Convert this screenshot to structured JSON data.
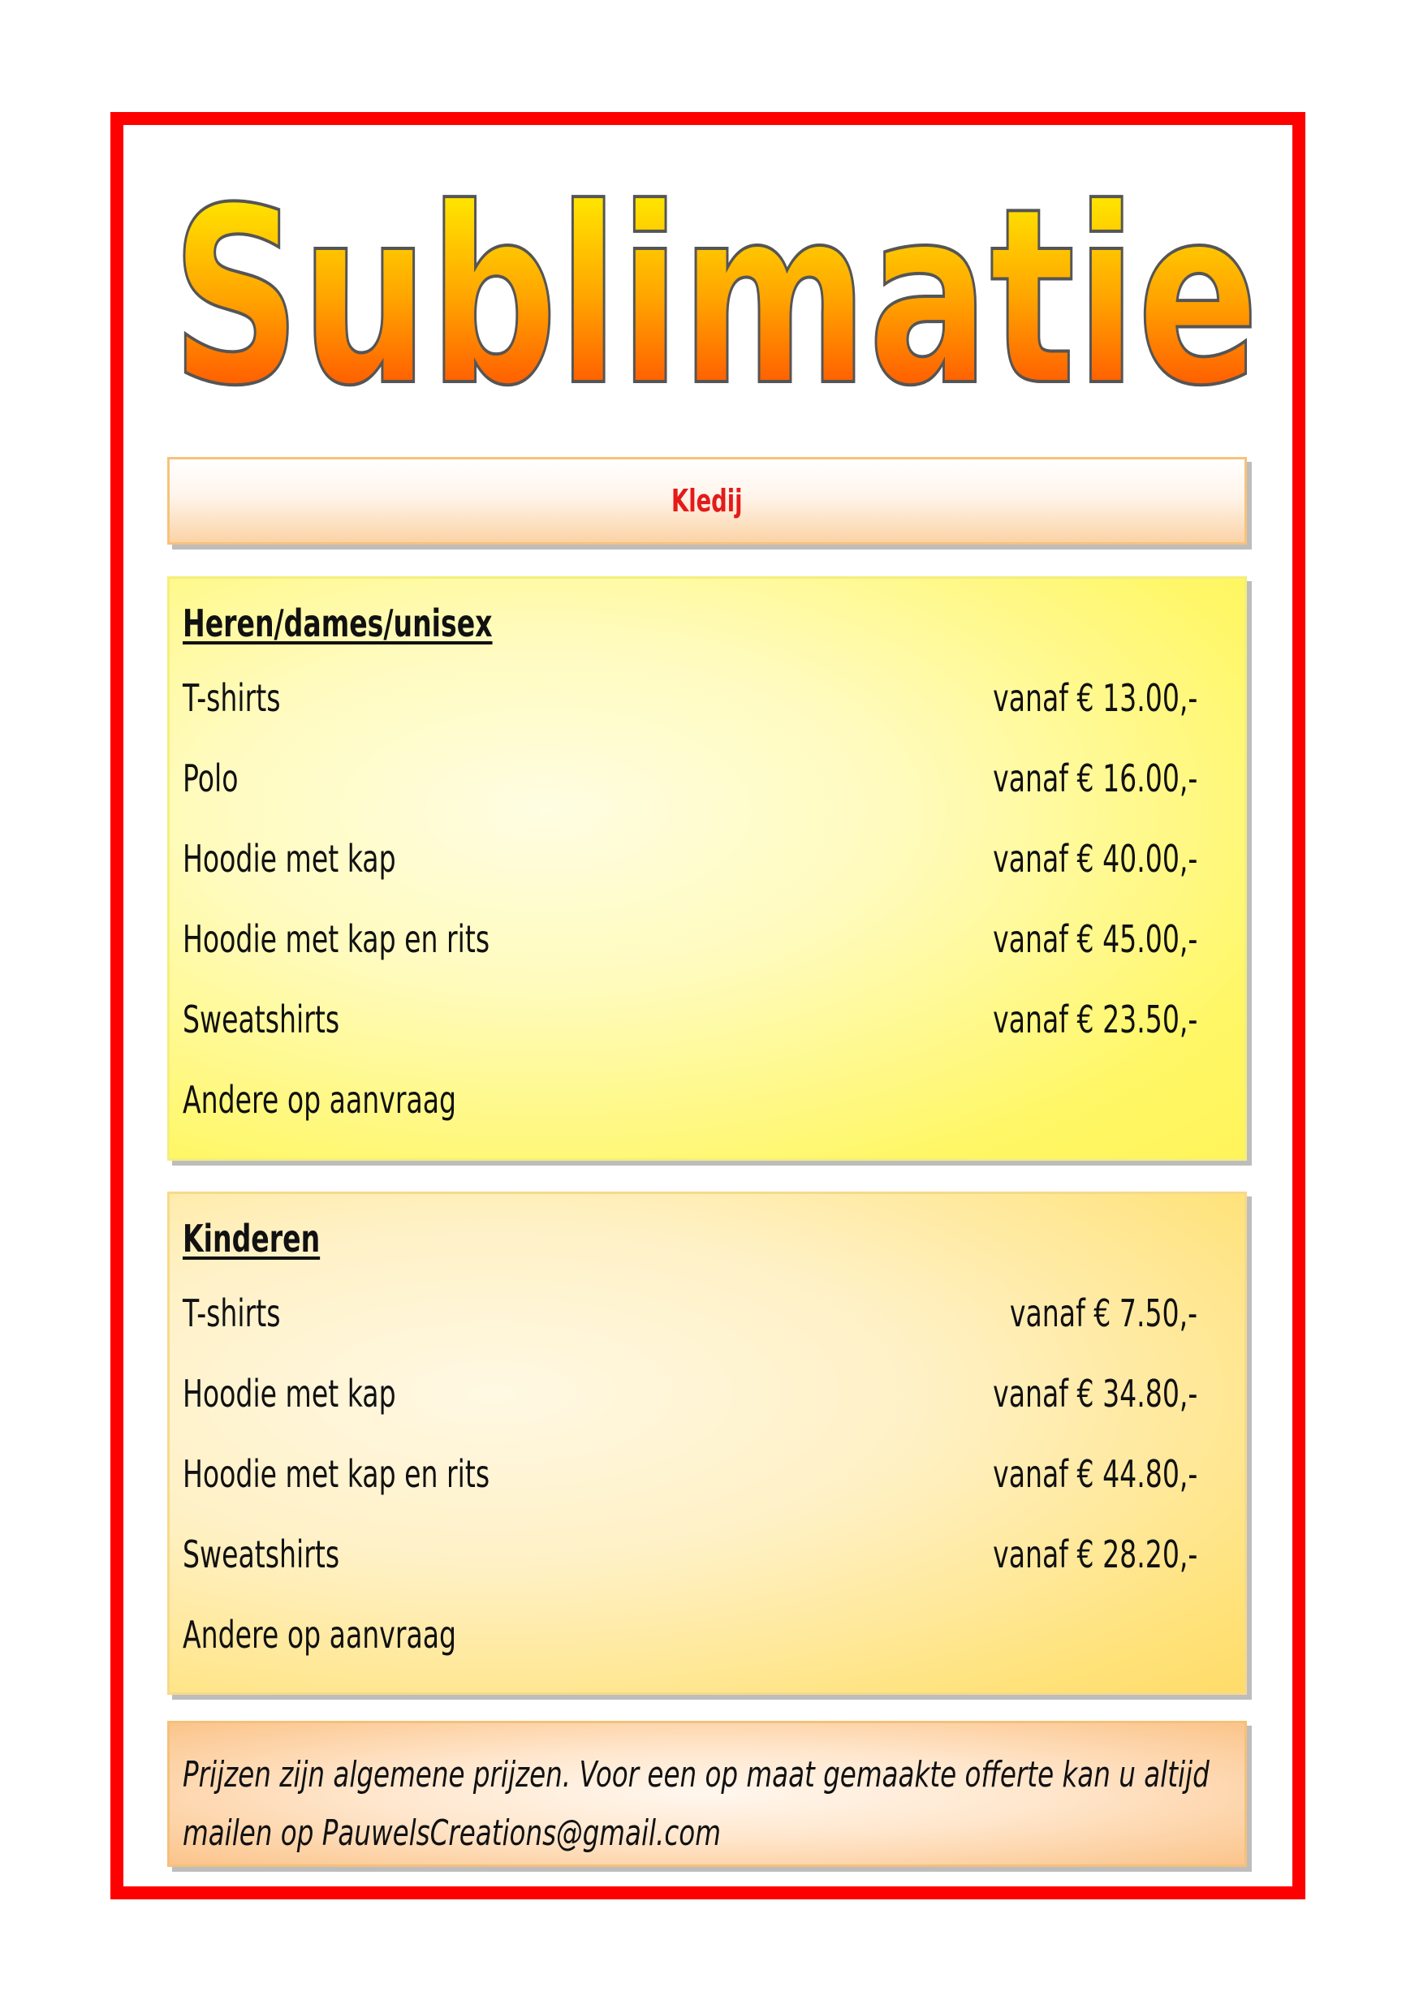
{
  "title": "Sublimatie",
  "header": {
    "label": "Kledij"
  },
  "sections": [
    {
      "title": "Heren/dames/unisex",
      "items": [
        {
          "name": "T-shirts",
          "price": "vanaf € 13.00,-"
        },
        {
          "name": "Polo",
          "price": "vanaf € 16.00,-"
        },
        {
          "name": "Hoodie met kap",
          "price": "vanaf € 40.00,-"
        },
        {
          "name": "Hoodie met kap en rits",
          "price": "vanaf € 45.00,-"
        },
        {
          "name": "Sweatshirts",
          "price": "vanaf € 23.50,-"
        },
        {
          "name": "Andere op aanvraag",
          "price": ""
        }
      ]
    },
    {
      "title": "Kinderen",
      "items": [
        {
          "name": "T-shirts",
          "price": "vanaf € 7.50,-"
        },
        {
          "name": "Hoodie met kap",
          "price": "vanaf € 34.80,-"
        },
        {
          "name": "Hoodie met kap en rits",
          "price": "vanaf € 44.80,-"
        },
        {
          "name": "Sweatshirts",
          "price": "vanaf € 28.20,-"
        },
        {
          "name": "Andere op aanvraag",
          "price": ""
        }
      ]
    }
  ],
  "note": {
    "line1": "Prijzen zijn algemene prijzen. Voor een op maat gemaakte offerte kan u altijd",
    "line2": "mailen op PauwelsCreations@gmail.com"
  },
  "colors": {
    "frame": "#ff0000",
    "heading_text": "#e31b1b",
    "title_top": "#ffff00",
    "title_bottom": "#ff3300"
  }
}
